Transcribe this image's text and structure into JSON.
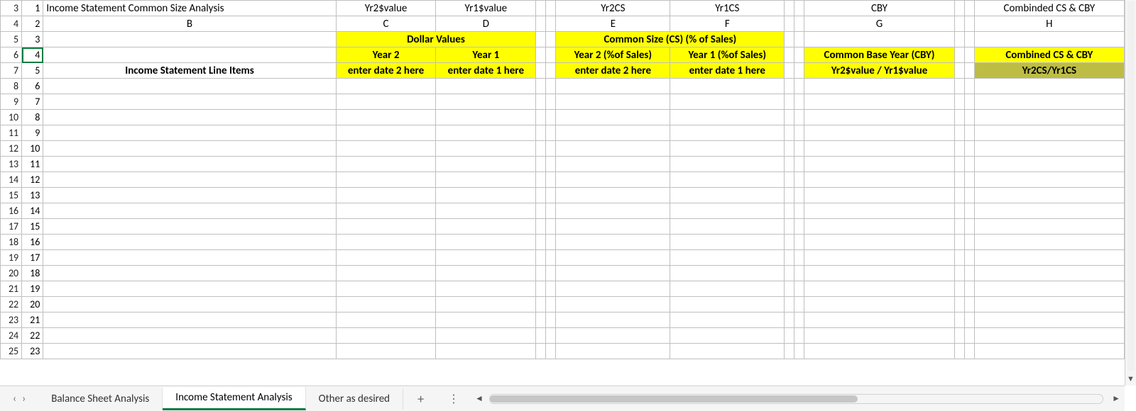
{
  "rows": {
    "r3": {
      "hdr": "3",
      "aux": "1",
      "B": "Income Statement Common Size Analysis",
      "C": "Yr2$value",
      "D": "Yr1$value",
      "E": "Yr2CS",
      "F": "Yr1CS",
      "G": "CBY",
      "H": "Combinded CS & CBY"
    },
    "r4": {
      "hdr": "4",
      "aux": "2",
      "B": "B",
      "C": "C",
      "D": "D",
      "E": "E",
      "F": "F",
      "G": "G",
      "H": "H"
    },
    "r5": {
      "hdr": "5",
      "aux": "3",
      "CD": "Dollar Values",
      "EF": "Common Size (CS) (% of Sales)"
    },
    "r6": {
      "hdr": "6",
      "aux": "4",
      "C": "Year 2",
      "D": "Year 1",
      "E": "Year 2 (%of Sales)",
      "F": "Year 1 (%of Sales)",
      "G": "Common Base Year (CBY)",
      "H": "Combined CS & CBY"
    },
    "r7": {
      "hdr": "7",
      "aux": "5",
      "B": "Income Statement Line Items",
      "C": "enter date 2 here",
      "D": "enter date 1 here",
      "E": "enter date 2 here",
      "F": "enter date 1 here",
      "G": "Yr2$value / Yr1$value",
      "H": "Yr2CS/Yr1CS"
    },
    "r8": {
      "hdr": "8",
      "aux": "6"
    },
    "r9": {
      "hdr": "9",
      "aux": "7"
    },
    "r10": {
      "hdr": "10",
      "aux": "8"
    },
    "r11": {
      "hdr": "11",
      "aux": "9"
    },
    "r12": {
      "hdr": "12",
      "aux": "10"
    },
    "r13": {
      "hdr": "13",
      "aux": "11"
    },
    "r14": {
      "hdr": "14",
      "aux": "12"
    },
    "r15": {
      "hdr": "15",
      "aux": "13"
    },
    "r16": {
      "hdr": "16",
      "aux": "14"
    },
    "r17": {
      "hdr": "17",
      "aux": "15"
    },
    "r18": {
      "hdr": "18",
      "aux": "16"
    },
    "r19": {
      "hdr": "19",
      "aux": "17"
    },
    "r20": {
      "hdr": "20",
      "aux": "18"
    },
    "r21": {
      "hdr": "21",
      "aux": "19"
    },
    "r22": {
      "hdr": "22",
      "aux": "20"
    },
    "r23": {
      "hdr": "23",
      "aux": "21"
    },
    "r24": {
      "hdr": "24",
      "aux": "22"
    },
    "r25": {
      "hdr": "25",
      "aux": "23"
    }
  },
  "tabs": {
    "t1": "Balance Sheet Analysis",
    "t2": "Income Statement Analysis",
    "t3": "Other as desired",
    "add": "+",
    "more": "⋮"
  },
  "nav": {
    "prev": "‹",
    "next": "›"
  },
  "hscroll": {
    "left": "◄",
    "right": "►"
  },
  "vscroll": {
    "down": "▼"
  }
}
